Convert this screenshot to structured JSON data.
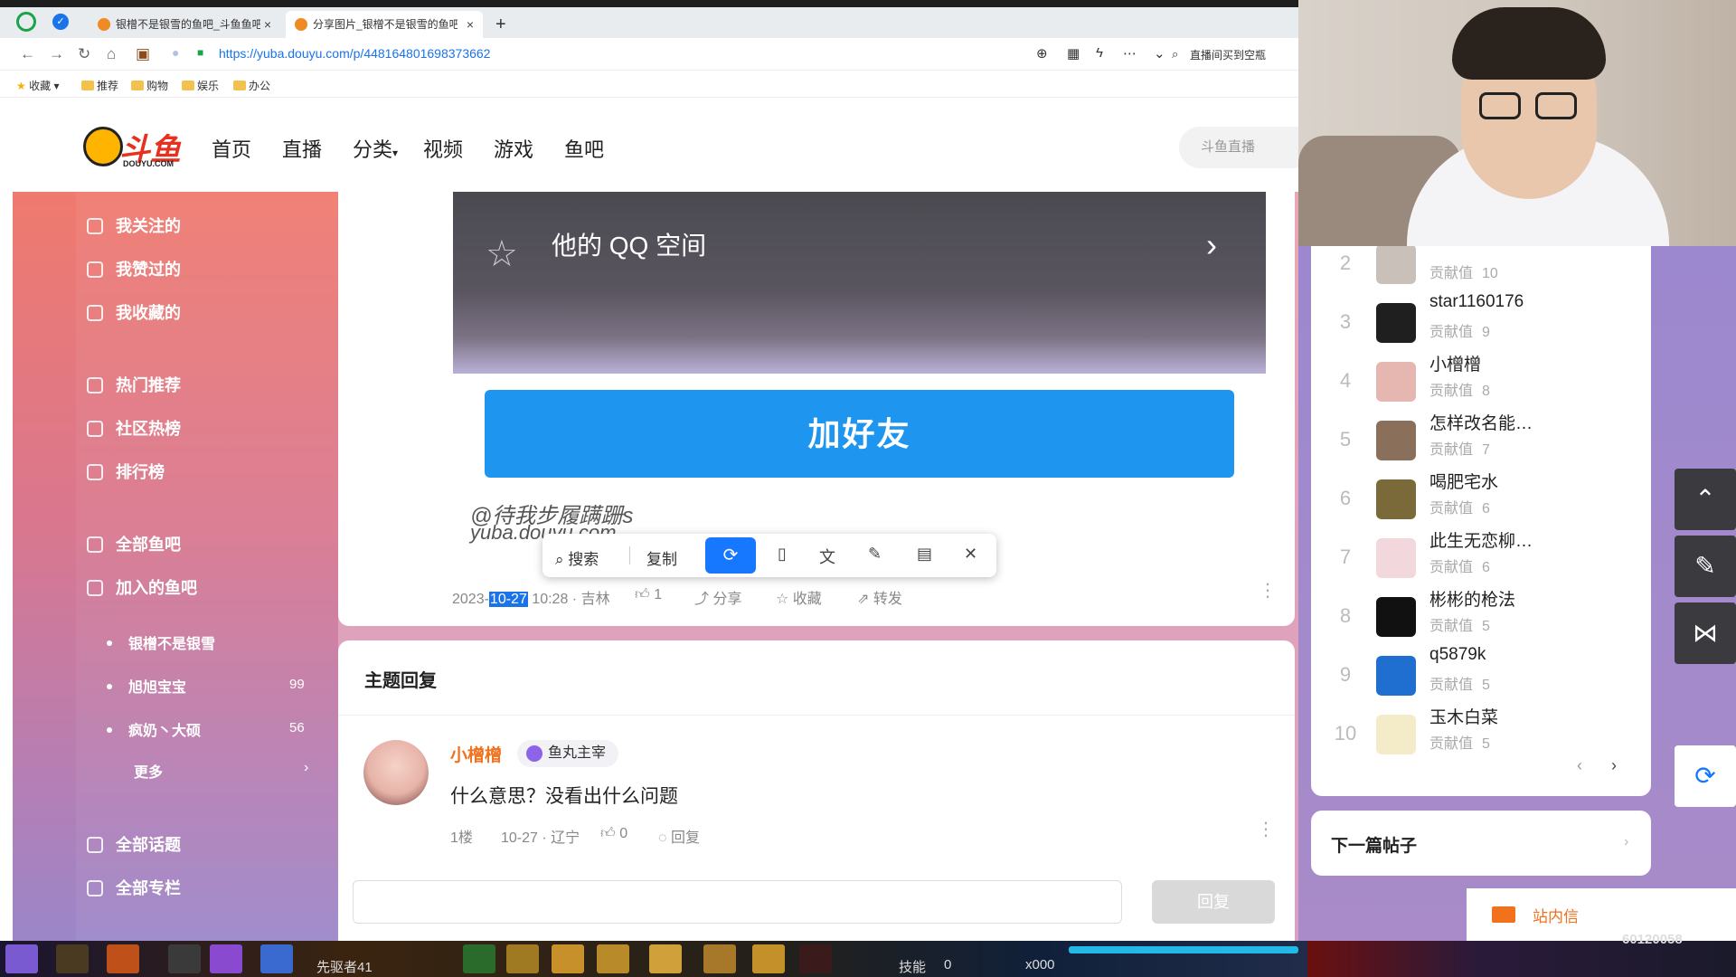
{
  "browser": {
    "tabs": [
      {
        "title": "银橧不是银雪的鱼吧_斗鱼鱼吧",
        "active": false
      },
      {
        "title": "分享图片_银橧不是银雪的鱼吧",
        "active": true
      }
    ],
    "new_tab": "+",
    "url": "https://yuba.douyu.com/p/448164801698373662",
    "right_search": "直播间买到空瓶",
    "bookmarks": [
      "收藏",
      "推荐",
      "购物",
      "娱乐",
      "办公"
    ]
  },
  "site": {
    "logo_text": "斗鱼",
    "logo_sub": "DOUYU.COM",
    "nav": [
      "首页",
      "直播",
      "分类",
      "视频",
      "游戏",
      "鱼吧"
    ],
    "nav_dropdown_mark": "▾",
    "search_placeholder": "斗鱼直播"
  },
  "sidebar": {
    "items_top": [
      "我关注的",
      "我赞过的",
      "我收藏的"
    ],
    "items_mid": [
      "热门推荐",
      "社区热榜",
      "排行榜"
    ],
    "items_bars": [
      "全部鱼吧",
      "加入的鱼吧"
    ],
    "joined": [
      {
        "name": "银橧不是银雪",
        "count": ""
      },
      {
        "name": "旭旭宝宝",
        "count": "99"
      },
      {
        "name": "疯奶丶大硕",
        "count": "56"
      }
    ],
    "more": "更多",
    "more_chevron": "›",
    "items_bottom": [
      "全部话题",
      "全部专栏"
    ]
  },
  "post": {
    "qq_title": "他的 QQ 空间",
    "qq_chevron": "›",
    "add_friend": "加好友",
    "watermark_line1": "@待我步履蹒跚s",
    "watermark_line2": "yuba.douyu.com",
    "meta": {
      "date_prefix": "2023-",
      "date_selected": "10-27",
      "time": "10:28",
      "location": "· 吉林",
      "likes": "1",
      "share": "分享",
      "collect": "收藏",
      "forward": "转发"
    }
  },
  "selection_popup": {
    "search": "搜索",
    "copy": "复制",
    "close": "✕"
  },
  "replies": {
    "title": "主题回复",
    "items": [
      {
        "name": "小橧橧",
        "badge": "鱼丸主宰",
        "text": "什么意思？没看出什么问题",
        "floor": "1楼",
        "date": "10-27 · 辽宁",
        "likes": "0",
        "reply": "回复"
      }
    ],
    "submit": "回复"
  },
  "ranking": {
    "score_label": "贡献值",
    "entries": [
      {
        "rank": "2",
        "name": "",
        "score": "10",
        "color": "#c9c1b9"
      },
      {
        "rank": "3",
        "name": "star1160176",
        "score": "9",
        "color": "#1f1f1f"
      },
      {
        "rank": "4",
        "name": "小橧橧",
        "score": "8",
        "color": "#e6b7b0"
      },
      {
        "rank": "5",
        "name": "怎样改名能…",
        "score": "7",
        "color": "#8a6f5a"
      },
      {
        "rank": "6",
        "name": "喝肥宅水",
        "score": "6",
        "color": "#7a6a3a"
      },
      {
        "rank": "7",
        "name": "此生无恋柳…",
        "score": "6",
        "color": "#f2d8dc"
      },
      {
        "rank": "8",
        "name": "彬彬的枪法",
        "score": "5",
        "color": "#111111"
      },
      {
        "rank": "9",
        "name": "q5879k",
        "score": "5",
        "color": "#1e6fd0"
      },
      {
        "rank": "10",
        "name": "玉木白菜",
        "score": "5",
        "color": "#f4ecc8"
      }
    ],
    "prev": "‹",
    "next": "›"
  },
  "next_post": {
    "title": "下一篇帖子",
    "chevron": "›"
  },
  "mail": {
    "label": "站内信"
  },
  "gamebar": {
    "text1": "先驱者41",
    "text2": "技能",
    "text3": "0",
    "text4": "x000",
    "text5": "60120058"
  },
  "colors": {
    "accent_blue": "#1e96f0",
    "douyu_orange": "#f2711c",
    "douyu_red": "#e8301f"
  }
}
